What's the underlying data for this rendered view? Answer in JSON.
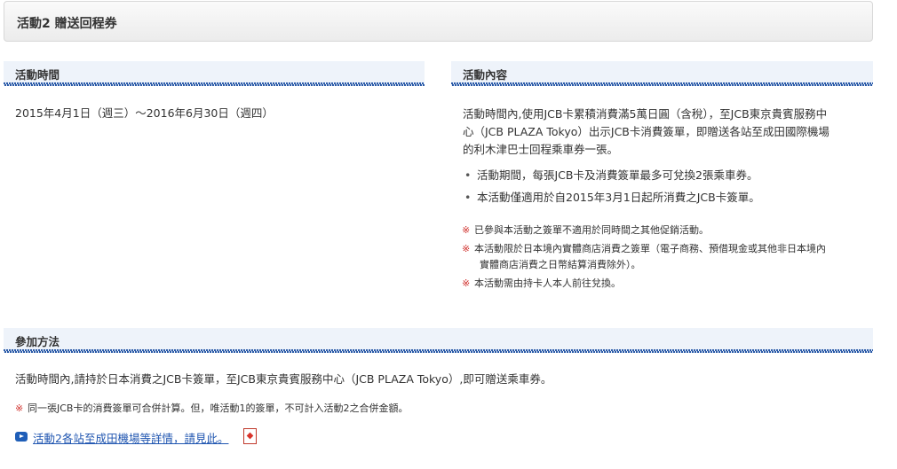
{
  "title": "活動2 贈送回程券",
  "sections": {
    "period": {
      "heading": "活動時間",
      "text": "2015年4月1日（週三）～2016年6月30日（週四）"
    },
    "content": {
      "heading": "活動內容",
      "paragraph_lines": [
        "活動時間內,使用JCB卡累積消費滿5萬日圓（含稅），至JCB東京貴賓服務中",
        "心（JCB PLAZA Tokyo）出示JCB卡消費簽單，即贈送各站至成田國際機場",
        "的利木津巴士回程乘車券一張。"
      ],
      "bullets": [
        "活動期間，每張JCB卡及消費簽單最多可兌換2張乘車券。",
        "本活動僅適用於自2015年3月1日起所消費之JCB卡簽單。"
      ],
      "notes": [
        [
          "已參與本活動之簽單不適用於同時間之其他促銷活動。"
        ],
        [
          "本活動限於日本境內實體商店消費之簽單（電子商務、預借現金或其他非日本境內",
          "實體商店消費之日幣結算消費除外）。"
        ],
        [
          "本活動需由持卡人本人前往兌換。"
        ]
      ]
    },
    "method": {
      "heading": "參加方法",
      "text": "活動時間內,請持於日本消費之JCB卡簽單，至JCB東京貴賓服務中心（JCB PLAZA Tokyo）,即可贈送乘車券。",
      "note": "同一張JCB卡的消費簽單可合併計算。但，唯活動1的簽單，不可計入活動2之合併金額。",
      "link": "活動2各站至成田機場等詳情，請見此。"
    }
  },
  "note_mark": "※",
  "bullet_mark": "•",
  "icons": {
    "link": "arrow-right-icon",
    "pdf": "pdf-icon"
  },
  "colors": {
    "link": "#1f55b0",
    "note_mark": "#d0302c",
    "heading_bg": "#eef3fa",
    "dots": "#2a5aa8"
  }
}
